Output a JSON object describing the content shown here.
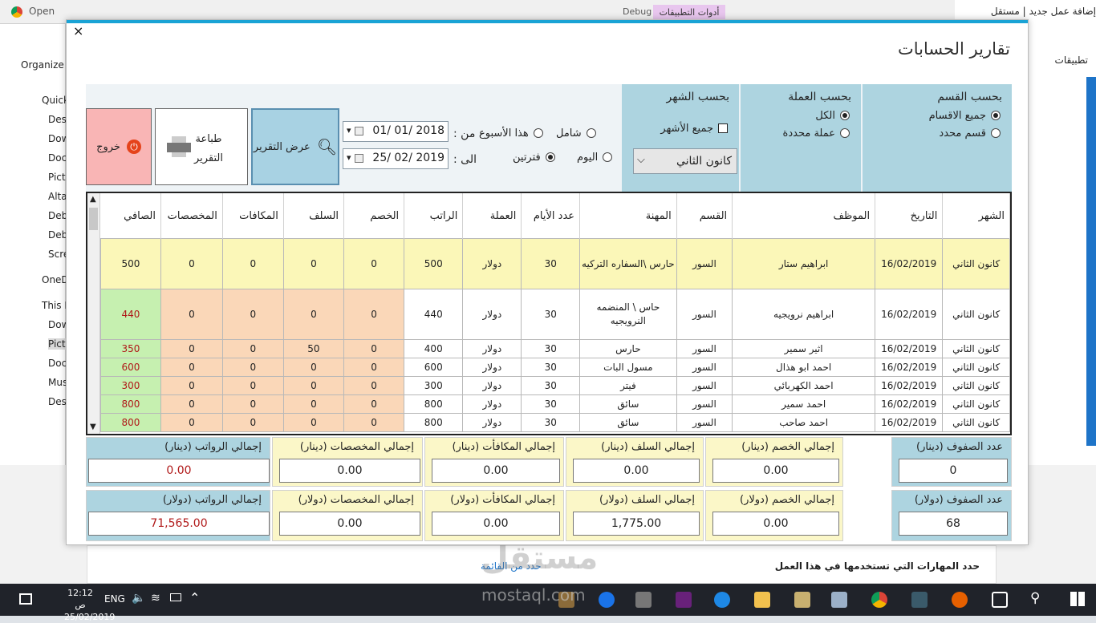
{
  "background": {
    "tab_title": "Open",
    "app_tools": "أدوات التطبيقات",
    "debug": "Debug",
    "right_tab": "إضافة عمل جديد | مستقل",
    "organize": "Organize",
    "apps_label": "تطبيقات",
    "nav": [
      "Quick",
      "Desk",
      "Dow",
      "Doc",
      "Pict",
      "Alta",
      "Deb",
      "Deb",
      "Scre",
      "OneD",
      "This P",
      "Dow",
      "Pict",
      "Doc",
      "Mus",
      "Desk"
    ],
    "bottom_text": "حدد المهارات التي تستخدمها في هذا العمل",
    "bottom_link": "حدد من القائمة",
    "watermark": "مستقل",
    "watermark_url": "mostaql.com"
  },
  "dialog": {
    "close": "×",
    "title": "تقارير الحسابات"
  },
  "filters": {
    "section": {
      "title": "بحسب القسم",
      "options": [
        "جميع الاقسام",
        "قسم محدد"
      ],
      "selected": 0
    },
    "currency": {
      "title": "بحسب العملة",
      "options": [
        "الكل",
        "عملة محددة"
      ],
      "selected": 0
    },
    "month": {
      "title": "بحسب الشهر",
      "all_label": "جميع الأشهر",
      "all_checked": false,
      "combo_value": "كانون الثاني",
      "combo_arrow": "⌵"
    },
    "period": {
      "options": [
        "شامل",
        "هذا الأسبوع",
        "اليوم",
        "فترتين"
      ],
      "selected": "فترتين",
      "from_label": "من :",
      "to_label": "الى :",
      "from_date": "01/ 01/ 2018",
      "to_date": "25/ 02/ 2019"
    },
    "buttons": {
      "show": "عرض التقرير",
      "print": "طباعة التقرير",
      "exit": "خروج"
    }
  },
  "table": {
    "headers": [
      "الشهر",
      "التاريخ",
      "الموظف",
      "القسم",
      "المهنة",
      "عدد الأيام",
      "العملة",
      "الراتب",
      "الخصم",
      "السلف",
      "المكافات",
      "المخصصات",
      "الصافي"
    ],
    "rows": [
      [
        "كانون الثاني",
        "16/02/2019",
        "ابراهيم ستار",
        "السور",
        "حارس \\السفاره التركيه",
        "30",
        "دولار",
        "500",
        "0",
        "0",
        "0",
        "0",
        "500"
      ],
      [
        "كانون الثاني",
        "16/02/2019",
        "ابراهيم نرويجيه",
        "السور",
        "حاس \\ المنضمه النرويجيه",
        "30",
        "دولار",
        "440",
        "0",
        "0",
        "0",
        "0",
        "440"
      ],
      [
        "كانون الثاني",
        "16/02/2019",
        "اثير سمير",
        "السور",
        "حارس",
        "30",
        "دولار",
        "400",
        "0",
        "50",
        "0",
        "0",
        "350"
      ],
      [
        "كانون الثاني",
        "16/02/2019",
        "احمد ابو هذال",
        "السور",
        "مسول البات",
        "30",
        "دولار",
        "600",
        "0",
        "0",
        "0",
        "0",
        "600"
      ],
      [
        "كانون الثاني",
        "16/02/2019",
        "احمد الكهربائي",
        "السور",
        "فيتر",
        "30",
        "دولار",
        "300",
        "0",
        "0",
        "0",
        "0",
        "300"
      ],
      [
        "كانون الثاني",
        "16/02/2019",
        "احمد سمير",
        "السور",
        "سائق",
        "30",
        "دولار",
        "800",
        "0",
        "0",
        "0",
        "0",
        "800"
      ],
      [
        "كانون الثاني",
        "16/02/2019",
        "احمد صاحب",
        "السور",
        "سائق",
        "30",
        "دولار",
        "800",
        "0",
        "0",
        "0",
        "0",
        "800"
      ]
    ]
  },
  "totals": {
    "dinar": {
      "rows_label": "عدد الصفوف (دينار)",
      "rows": "0",
      "discount_label": "إجمالي الخصم (دينار)",
      "discount": "0.00",
      "advances_label": "إجمالي السلف (دينار)",
      "advances": "0.00",
      "bonuses_label": "إجمالي المكافأت (دينار)",
      "bonuses": "0.00",
      "allowances_label": "إجمالي المخصصات (دينار)",
      "allowances": "0.00",
      "salaries_label": "إجمالي الرواتب (دينار)",
      "salaries": "0.00"
    },
    "dollar": {
      "rows_label": "عدد الصفوف (دولار)",
      "rows": "68",
      "discount_label": "إجمالي الخصم (دولار)",
      "discount": "0.00",
      "advances_label": "إجمالي السلف (دولار)",
      "advances": "1,775.00",
      "bonuses_label": "إجمالي المكافأت (دولار)",
      "bonuses": "0.00",
      "allowances_label": "إجمالي المخصصات (دولار)",
      "allowances": "0.00",
      "salaries_label": "إجمالي الرواتب (دولار)",
      "salaries": "71,565.00"
    }
  },
  "taskbar": {
    "time": "12:12 ص",
    "date": "25/02/2019",
    "lang": "ENG"
  }
}
